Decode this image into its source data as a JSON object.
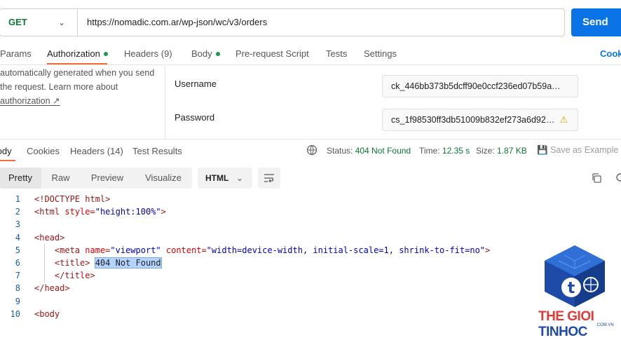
{
  "request": {
    "method": "GET",
    "url": "https://nomadic.com.ar/wp-json/wc/v3/orders",
    "send_label": "Send"
  },
  "request_tabs": [
    {
      "label": "Params",
      "active": false,
      "dot": false
    },
    {
      "label": "Authorization",
      "active": true,
      "dot": true
    },
    {
      "label": "Headers (9)",
      "active": false,
      "dot": false
    },
    {
      "label": "Body",
      "active": false,
      "dot": true
    },
    {
      "label": "Pre-request Script",
      "active": false,
      "dot": false
    },
    {
      "label": "Tests",
      "active": false,
      "dot": false
    },
    {
      "label": "Settings",
      "active": false,
      "dot": false
    }
  ],
  "cookies_label": "Cook",
  "auth": {
    "note_line1": "automatically generated when you send",
    "note_line2": "the request. Learn more about",
    "note_link": "authorization ↗",
    "username_label": "Username",
    "username_value": "ck_446bb373b5dcff90e0ccf236ed07b59a…",
    "password_label": "Password",
    "password_value": "cs_1f98530ff3db51009b832ef273a6d92…"
  },
  "response_tabs": [
    {
      "label": "Body",
      "active": true
    },
    {
      "label": "Cookies",
      "active": false
    },
    {
      "label": "Headers (14)",
      "active": false
    },
    {
      "label": "Test Results",
      "active": false
    }
  ],
  "response_meta": {
    "status_label": "Status:",
    "status_value": "404 Not Found",
    "time_label": "Time:",
    "time_value": "12.35 s",
    "size_label": "Size:",
    "size_value": "1.87 KB",
    "save_example": "Save as Example"
  },
  "view_modes": [
    "Pretty",
    "Raw",
    "Preview",
    "Visualize"
  ],
  "language": "HTML",
  "code_lines": [
    {
      "n": "1",
      "t": [
        [
          "tag",
          "<!DOCTYPE html>"
        ]
      ]
    },
    {
      "n": "2",
      "t": [
        [
          "tag",
          "<html "
        ],
        [
          "attr",
          "style="
        ],
        [
          "str",
          "\"height:100%\""
        ],
        [
          "tag",
          ">"
        ]
      ]
    },
    {
      "n": "3",
      "t": []
    },
    {
      "n": "4",
      "t": [
        [
          "tag",
          "<head>"
        ]
      ]
    },
    {
      "n": "5",
      "t": [
        [
          "plain",
          "    "
        ],
        [
          "tag",
          "<meta "
        ],
        [
          "attr",
          "name="
        ],
        [
          "str",
          "\"viewport\" "
        ],
        [
          "attr",
          "content="
        ],
        [
          "str",
          "\"width=device-width, initial-scale=1, shrink-to-fit=no\""
        ],
        [
          "tag",
          ">"
        ]
      ]
    },
    {
      "n": "6",
      "t": [
        [
          "plain",
          "    "
        ],
        [
          "tag",
          "<title> "
        ],
        [
          "sel",
          "404 Not Found"
        ]
      ]
    },
    {
      "n": "7",
      "t": [
        [
          "plain",
          "    "
        ],
        [
          "tag",
          "</title>"
        ]
      ]
    },
    {
      "n": "8",
      "t": [
        [
          "tag",
          "</head>"
        ]
      ]
    },
    {
      "n": "9",
      "t": []
    },
    {
      "n": "10",
      "t": [
        [
          "tag",
          "<body"
        ]
      ]
    }
  ],
  "watermark": {
    "brand_part1": "THE GIOI ",
    "brand_part2": "TINHOC",
    "brand_sub": ".COM.VN",
    "logo_letter": "t",
    "colors": {
      "red": "#e53935",
      "blue": "#1e4aa8"
    }
  },
  "colors": {
    "accent": "#0a74e6",
    "tab_underline": "#f26b3a",
    "status_ok": "#0b7a34"
  }
}
